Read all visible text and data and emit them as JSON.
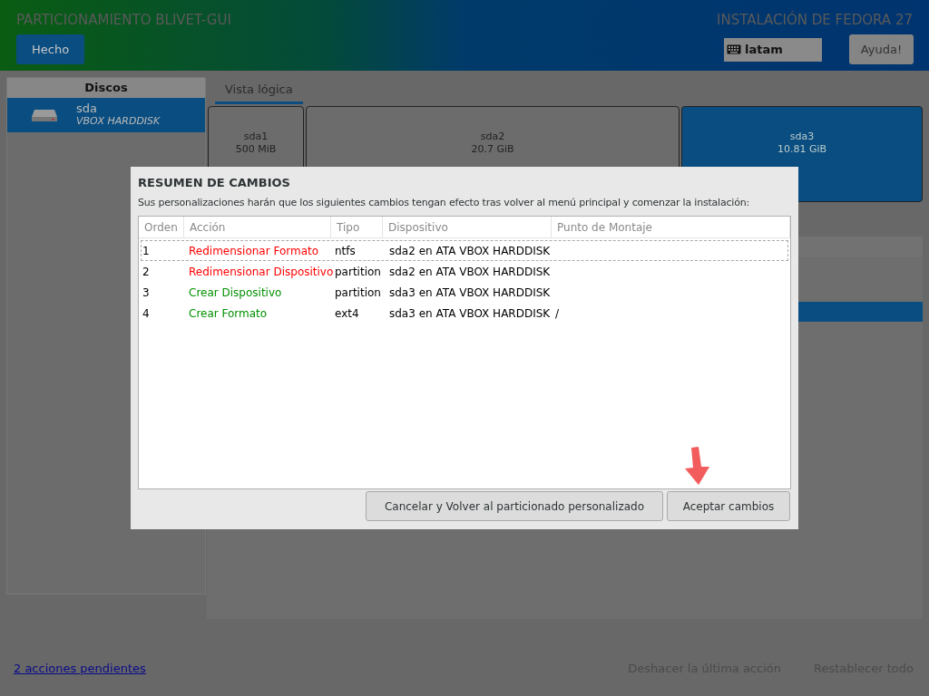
{
  "header": {
    "title": "PARTICIONAMIENTO BLIVET-GUI",
    "done_button": "Hecho",
    "product": "INSTALACIÓN DE FEDORA 27",
    "keyboard": "latam",
    "help_button": "Ayuda!"
  },
  "sidebar": {
    "heading": "Discos",
    "disks": [
      {
        "name": "sda",
        "model": "VBOX HARDDISK",
        "selected": true
      }
    ]
  },
  "tabs": [
    {
      "label": "Vista lógica",
      "selected": true
    }
  ],
  "partitions": [
    {
      "name": "sda1",
      "size": "500 MiB",
      "selected": false
    },
    {
      "name": "sda2",
      "size": "20.7 GiB",
      "selected": false
    },
    {
      "name": "sda3",
      "size": "10.81 GiB",
      "selected": true
    }
  ],
  "dialog": {
    "title": "RESUMEN DE CAMBIOS",
    "message": "Sus personalizaciones harán que los siguientes cambios tengan efecto tras volver al menú principal y comenzar la instalación:",
    "columns": [
      "Orden",
      "Acción",
      "Tipo",
      "Dispositivo",
      "Punto de Montaje"
    ],
    "rows": [
      {
        "order": "1",
        "action": "Redimensionar Formato",
        "color": "#ff0000",
        "type": "ntfs",
        "device": "sda2 en ATA VBOX HARDDISK",
        "mount": "",
        "selected": true
      },
      {
        "order": "2",
        "action": "Redimensionar Dispositivo",
        "color": "#ff0000",
        "type": "partition",
        "device": "sda2 en ATA VBOX HARDDISK",
        "mount": "",
        "selected": false
      },
      {
        "order": "3",
        "action": "Crear Dispositivo",
        "color": "#009000",
        "type": "partition",
        "device": "sda3 en ATA VBOX HARDDISK",
        "mount": "",
        "selected": false
      },
      {
        "order": "4",
        "action": "Crear Formato",
        "color": "#009000",
        "type": "ext4",
        "device": "sda3 en ATA VBOX HARDDISK",
        "mount": "/",
        "selected": false
      }
    ],
    "cancel_button": "Cancelar y Volver al particionado personalizado",
    "accept_button": "Aceptar cambios"
  },
  "footer": {
    "pending_link": "2 acciones pendientes",
    "undo_button": "Deshacer la última acción",
    "reset_button": "Restablecer todo"
  }
}
